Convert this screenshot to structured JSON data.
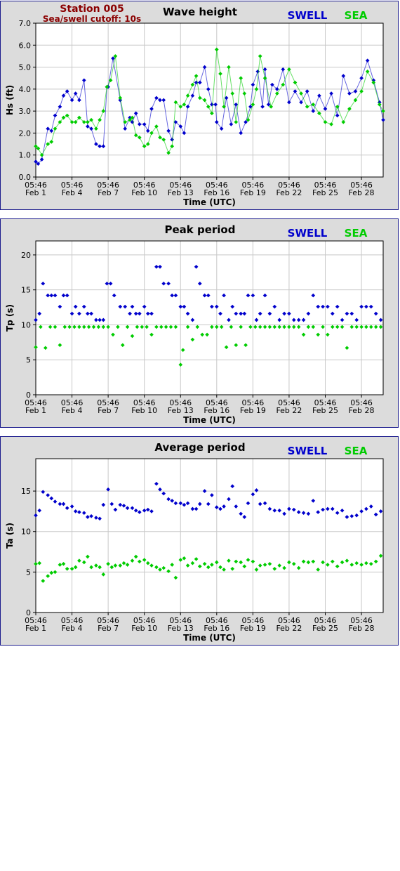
{
  "header": {
    "station": "Station 005",
    "cutoff": "Sea/swell cutoff: 10s"
  },
  "colors": {
    "swell": "#0000cc",
    "sea": "#00cc00",
    "title": "#8b0000"
  },
  "time_axis": {
    "time_labels": [
      "05:46",
      "05:46",
      "05:46",
      "05:46",
      "05:46",
      "05:46",
      "05:46",
      "05:46",
      "05:46",
      "05:46"
    ],
    "date_labels": [
      "Feb 1",
      "Feb 4",
      "Feb 7",
      "Feb 10",
      "Feb 13",
      "Feb 16",
      "Feb 19",
      "Feb 22",
      "Feb 25",
      "Feb 28"
    ],
    "tick_days": [
      1,
      4,
      7,
      10,
      13,
      16,
      19,
      22,
      25,
      28
    ],
    "xlabel": "Time (UTC)",
    "xlim": [
      1,
      29.8
    ]
  },
  "chart_data": [
    {
      "type": "line",
      "title": "Wave height",
      "ylabel": "Hs (ft)",
      "ylim": [
        0,
        7
      ],
      "yticks": [
        "0.0",
        "1.0",
        "2.0",
        "3.0",
        "4.0",
        "5.0",
        "6.0",
        "7.0"
      ],
      "grid": true,
      "legend_position": "top-right",
      "series": [
        {
          "name": "SWELL",
          "x": [
            1.0,
            1.2,
            1.5,
            2.0,
            2.3,
            2.6,
            3.0,
            3.3,
            3.6,
            4.0,
            4.3,
            4.6,
            5.0,
            5.3,
            5.6,
            6.0,
            6.3,
            6.6,
            6.9,
            7.0,
            7.4,
            8.0,
            8.4,
            8.8,
            9.0,
            9.3,
            9.6,
            10.0,
            10.3,
            10.6,
            11.0,
            11.3,
            11.6,
            12.0,
            12.3,
            12.6,
            13.0,
            13.3,
            13.6,
            14.0,
            14.3,
            14.6,
            15.0,
            15.3,
            15.6,
            15.9,
            16.0,
            16.4,
            16.8,
            17.2,
            17.6,
            18.0,
            18.4,
            18.8,
            19.0,
            19.4,
            19.8,
            20.0,
            20.3,
            20.6,
            21.0,
            21.5,
            22.0,
            22.5,
            23.0,
            23.5,
            24.0,
            24.5,
            25.0,
            25.5,
            26.0,
            26.5,
            27.0,
            27.5,
            28.0,
            28.5,
            29.0,
            29.5,
            29.8
          ],
          "values": [
            0.7,
            0.6,
            0.8,
            2.2,
            2.1,
            2.8,
            3.2,
            3.7,
            3.9,
            3.5,
            3.8,
            3.5,
            4.4,
            2.3,
            2.2,
            1.5,
            1.4,
            1.4,
            4.1,
            4.1,
            5.4,
            3.5,
            2.2,
            2.7,
            2.5,
            2.9,
            2.4,
            2.4,
            2.1,
            3.1,
            3.6,
            3.5,
            3.5,
            2.1,
            1.7,
            2.5,
            2.3,
            2.0,
            3.2,
            3.7,
            4.3,
            4.3,
            5.0,
            4.0,
            3.3,
            3.3,
            2.5,
            2.2,
            3.6,
            2.4,
            3.3,
            2.0,
            2.5,
            3.2,
            4.2,
            4.8,
            3.2,
            4.9,
            3.3,
            4.2,
            4.0,
            4.9,
            3.4,
            3.9,
            3.4,
            3.9,
            3.0,
            3.7,
            3.1,
            3.8,
            2.8,
            4.6,
            3.8,
            3.9,
            4.5,
            5.3,
            4.4,
            3.4,
            2.6
          ]
        },
        {
          "name": "SEA",
          "x": [
            1.0,
            1.2,
            1.5,
            2.0,
            2.3,
            2.6,
            3.0,
            3.3,
            3.6,
            4.0,
            4.3,
            4.6,
            5.0,
            5.3,
            5.6,
            6.0,
            6.3,
            6.6,
            6.9,
            7.2,
            7.6,
            8.0,
            8.4,
            8.8,
            9.0,
            9.3,
            9.6,
            10.0,
            10.3,
            10.6,
            11.0,
            11.3,
            11.6,
            12.0,
            12.3,
            12.6,
            13.0,
            13.3,
            13.6,
            14.0,
            14.3,
            14.6,
            15.0,
            15.3,
            15.6,
            16.0,
            16.3,
            16.6,
            17.0,
            17.3,
            17.6,
            18.0,
            18.3,
            18.6,
            19.0,
            19.3,
            19.6,
            20.0,
            20.5,
            21.0,
            21.5,
            22.0,
            22.5,
            23.0,
            23.5,
            24.0,
            24.5,
            25.0,
            25.5,
            26.0,
            26.5,
            27.0,
            27.5,
            28.0,
            28.5,
            29.0,
            29.5,
            29.8
          ],
          "values": [
            1.4,
            1.3,
            1.0,
            1.5,
            1.6,
            2.2,
            2.5,
            2.7,
            2.8,
            2.5,
            2.5,
            2.7,
            2.5,
            2.5,
            2.6,
            2.2,
            2.6,
            3.0,
            4.1,
            4.4,
            5.5,
            3.6,
            2.5,
            2.6,
            2.7,
            1.9,
            1.8,
            1.4,
            1.5,
            2.0,
            2.3,
            1.8,
            1.7,
            1.1,
            1.4,
            3.4,
            3.2,
            3.3,
            3.7,
            4.2,
            4.6,
            3.6,
            3.5,
            3.2,
            2.9,
            5.8,
            4.7,
            3.2,
            5.0,
            3.8,
            2.5,
            4.5,
            3.8,
            2.6,
            3.3,
            4.0,
            5.5,
            4.5,
            3.2,
            3.8,
            4.2,
            4.9,
            4.3,
            3.8,
            3.2,
            3.3,
            2.9,
            2.5,
            2.4,
            3.2,
            2.5,
            3.1,
            3.5,
            3.9,
            4.8,
            4.3,
            3.3,
            3.0
          ]
        }
      ]
    },
    {
      "type": "scatter",
      "title": "Peak period",
      "ylabel": "Tp (s)",
      "ylim": [
        0,
        22
      ],
      "yticks": [
        "0",
        "5",
        "10",
        "15",
        "20"
      ],
      "grid": true,
      "legend_position": "top-right",
      "series": [
        {
          "name": "SWELL",
          "x": [
            1.0,
            1.3,
            1.6,
            2.0,
            2.3,
            2.6,
            3.0,
            3.3,
            3.6,
            4.0,
            4.3,
            4.6,
            5.0,
            5.3,
            5.6,
            6.0,
            6.3,
            6.6,
            6.9,
            7.2,
            7.5,
            8.0,
            8.4,
            8.8,
            9.0,
            9.3,
            9.6,
            10.0,
            10.3,
            10.6,
            11.0,
            11.3,
            11.6,
            12.0,
            12.3,
            12.6,
            13.0,
            13.3,
            13.6,
            14.0,
            14.3,
            14.6,
            15.0,
            15.3,
            15.6,
            16.0,
            16.3,
            16.6,
            17.0,
            17.3,
            17.6,
            18.0,
            18.3,
            18.6,
            19.0,
            19.3,
            19.6,
            20.0,
            20.4,
            20.8,
            21.2,
            21.6,
            22.0,
            22.4,
            22.8,
            23.2,
            23.6,
            24.0,
            24.4,
            24.8,
            25.2,
            25.6,
            26.0,
            26.4,
            26.8,
            27.2,
            27.6,
            28.0,
            28.4,
            28.8,
            29.2,
            29.6
          ],
          "values": [
            10.7,
            11.6,
            15.9,
            14.2,
            14.2,
            14.2,
            12.6,
            14.2,
            14.2,
            11.6,
            12.6,
            11.6,
            12.6,
            11.6,
            11.6,
            10.7,
            10.7,
            10.7,
            15.9,
            15.9,
            14.2,
            12.6,
            12.6,
            11.6,
            12.6,
            11.6,
            11.6,
            12.6,
            11.6,
            11.6,
            18.3,
            18.3,
            15.9,
            15.9,
            14.2,
            14.2,
            12.6,
            12.6,
            11.6,
            10.7,
            18.3,
            15.9,
            14.2,
            14.2,
            12.6,
            12.6,
            11.6,
            14.2,
            10.7,
            12.6,
            11.6,
            11.6,
            11.6,
            14.2,
            14.2,
            10.7,
            11.6,
            14.2,
            11.6,
            12.6,
            10.7,
            11.6,
            11.6,
            10.7,
            10.7,
            10.7,
            11.6,
            14.2,
            12.6,
            12.6,
            12.6,
            11.6,
            12.6,
            10.7,
            11.6,
            11.6,
            10.7,
            12.6,
            12.6,
            12.6,
            11.6,
            10.7
          ]
        },
        {
          "name": "SEA",
          "x": [
            1.0,
            1.4,
            1.8,
            2.2,
            2.6,
            3.0,
            3.4,
            3.8,
            4.2,
            4.6,
            5.0,
            5.4,
            5.8,
            6.2,
            6.6,
            7.0,
            7.4,
            7.8,
            8.2,
            8.6,
            9.0,
            9.4,
            9.8,
            10.2,
            10.6,
            11.0,
            11.4,
            11.8,
            12.2,
            12.6,
            13.0,
            13.2,
            13.6,
            14.0,
            14.4,
            14.8,
            15.2,
            15.6,
            16.0,
            16.4,
            16.8,
            17.2,
            17.6,
            18.0,
            18.4,
            18.8,
            19.2,
            19.6,
            20.0,
            20.4,
            20.8,
            21.2,
            21.6,
            22.0,
            22.4,
            22.8,
            23.2,
            23.6,
            24.0,
            24.4,
            24.8,
            25.2,
            25.6,
            26.0,
            26.4,
            26.8,
            27.2,
            27.6,
            28.0,
            28.4,
            28.8,
            29.2,
            29.6
          ],
          "values": [
            6.8,
            9.7,
            6.7,
            9.7,
            9.7,
            7.1,
            9.7,
            9.7,
            9.7,
            9.7,
            9.7,
            9.7,
            9.7,
            9.7,
            9.7,
            9.7,
            8.6,
            9.7,
            7.1,
            9.7,
            8.4,
            9.7,
            9.7,
            9.7,
            8.6,
            9.7,
            9.7,
            9.7,
            9.7,
            9.7,
            4.3,
            6.4,
            9.7,
            7.9,
            9.7,
            8.6,
            8.6,
            9.7,
            9.7,
            9.7,
            6.8,
            9.7,
            7.1,
            9.7,
            7.1,
            9.7,
            9.7,
            9.7,
            9.7,
            9.7,
            9.7,
            9.7,
            9.7,
            9.7,
            9.7,
            9.7,
            8.6,
            9.7,
            9.7,
            8.6,
            9.7,
            8.6,
            9.7,
            9.7,
            9.7,
            6.7,
            9.7,
            9.7,
            9.7,
            9.7,
            9.7,
            9.7,
            9.7
          ]
        }
      ]
    },
    {
      "type": "scatter",
      "title": "Average period",
      "ylabel": "Ta (s)",
      "ylim": [
        0,
        19
      ],
      "yticks": [
        "0",
        "5",
        "10",
        "15"
      ],
      "grid": true,
      "legend_position": "top-right",
      "series": [
        {
          "name": "SWELL",
          "x": [
            1.0,
            1.3,
            1.6,
            2.0,
            2.3,
            2.6,
            3.0,
            3.3,
            3.6,
            4.0,
            4.3,
            4.6,
            5.0,
            5.3,
            5.6,
            6.0,
            6.3,
            6.6,
            7.0,
            7.3,
            7.6,
            8.0,
            8.3,
            8.6,
            9.0,
            9.3,
            9.6,
            10.0,
            10.3,
            10.6,
            11.0,
            11.3,
            11.6,
            12.0,
            12.3,
            12.6,
            13.0,
            13.3,
            13.6,
            14.0,
            14.3,
            14.6,
            15.0,
            15.3,
            15.6,
            16.0,
            16.3,
            16.6,
            17.0,
            17.3,
            17.6,
            18.0,
            18.3,
            18.6,
            19.0,
            19.3,
            19.6,
            20.0,
            20.4,
            20.8,
            21.2,
            21.6,
            22.0,
            22.4,
            22.8,
            23.2,
            23.6,
            24.0,
            24.4,
            24.8,
            25.2,
            25.6,
            26.0,
            26.4,
            26.8,
            27.2,
            27.6,
            28.0,
            28.4,
            28.8,
            29.2,
            29.6
          ],
          "values": [
            12.0,
            12.6,
            14.9,
            14.5,
            14.1,
            13.7,
            13.4,
            13.4,
            12.9,
            13.1,
            12.5,
            12.4,
            12.3,
            11.8,
            11.9,
            11.7,
            11.6,
            13.3,
            15.2,
            13.4,
            12.7,
            13.3,
            13.2,
            12.9,
            12.9,
            12.6,
            12.4,
            12.6,
            12.7,
            12.5,
            15.9,
            15.2,
            14.7,
            14.0,
            13.8,
            13.5,
            13.5,
            13.3,
            13.5,
            12.8,
            12.8,
            13.4,
            15.0,
            13.4,
            14.5,
            13.0,
            12.8,
            13.1,
            14.0,
            15.6,
            13.1,
            12.2,
            11.8,
            13.5,
            14.6,
            15.1,
            13.4,
            13.5,
            12.8,
            12.6,
            12.6,
            12.2,
            12.8,
            12.7,
            12.4,
            12.3,
            12.2,
            13.8,
            12.4,
            12.7,
            12.8,
            12.8,
            12.3,
            12.6,
            11.8,
            11.9,
            12.0,
            12.5,
            12.8,
            13.1,
            12.1,
            12.5
          ]
        },
        {
          "name": "SEA",
          "x": [
            1.0,
            1.3,
            1.6,
            2.0,
            2.3,
            2.6,
            3.0,
            3.3,
            3.6,
            4.0,
            4.3,
            4.6,
            5.0,
            5.3,
            5.6,
            6.0,
            6.3,
            6.6,
            7.0,
            7.3,
            7.6,
            8.0,
            8.3,
            8.6,
            9.0,
            9.3,
            9.6,
            10.0,
            10.3,
            10.6,
            11.0,
            11.3,
            11.6,
            12.0,
            12.3,
            12.6,
            13.0,
            13.3,
            13.6,
            14.0,
            14.3,
            14.6,
            15.0,
            15.3,
            15.6,
            16.0,
            16.3,
            16.6,
            17.0,
            17.3,
            17.6,
            18.0,
            18.3,
            18.6,
            19.0,
            19.3,
            19.6,
            20.0,
            20.4,
            20.8,
            21.2,
            21.6,
            22.0,
            22.4,
            22.8,
            23.2,
            23.6,
            24.0,
            24.4,
            24.8,
            25.2,
            25.6,
            26.0,
            26.4,
            26.8,
            27.2,
            27.6,
            28.0,
            28.4,
            28.8,
            29.2,
            29.6
          ],
          "values": [
            6.0,
            6.1,
            3.9,
            4.5,
            4.9,
            5.0,
            5.9,
            6.0,
            5.4,
            5.4,
            5.6,
            6.4,
            6.2,
            6.9,
            5.6,
            5.8,
            5.6,
            4.7,
            6.0,
            5.6,
            5.8,
            5.8,
            6.1,
            5.9,
            6.4,
            6.9,
            6.3,
            6.5,
            6.1,
            5.8,
            5.6,
            5.3,
            5.5,
            5.1,
            5.9,
            4.3,
            6.5,
            6.7,
            5.8,
            6.1,
            6.6,
            5.7,
            6.0,
            5.6,
            5.9,
            6.2,
            5.6,
            5.3,
            6.4,
            5.4,
            6.3,
            6.2,
            5.7,
            6.5,
            6.3,
            5.3,
            5.8,
            5.9,
            6.0,
            5.4,
            5.8,
            5.5,
            6.2,
            6.0,
            5.5,
            6.3,
            6.2,
            6.3,
            5.3,
            6.2,
            5.9,
            6.3,
            5.7,
            6.2,
            6.4,
            5.9,
            6.1,
            5.9,
            6.1,
            6.0,
            6.3,
            7.0
          ]
        }
      ]
    }
  ]
}
